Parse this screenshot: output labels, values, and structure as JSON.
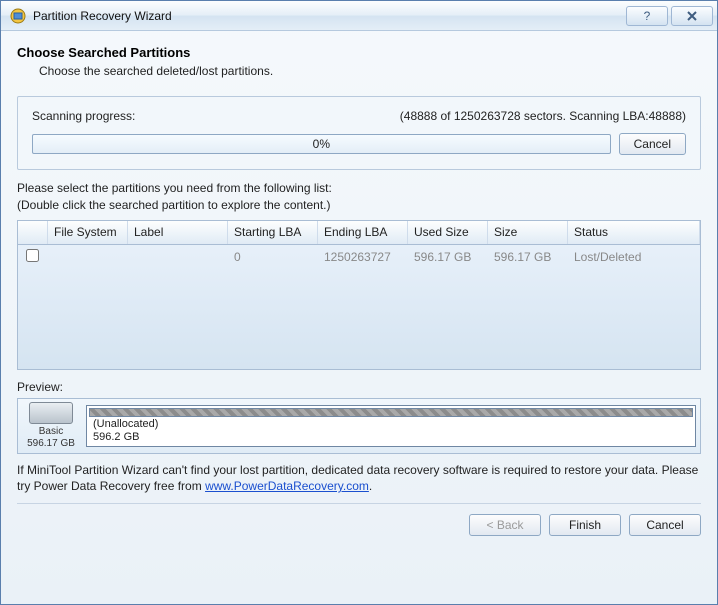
{
  "window": {
    "title": "Partition Recovery Wizard"
  },
  "header": {
    "title": "Choose Searched Partitions",
    "subtitle": "Choose the searched deleted/lost partitions."
  },
  "scan": {
    "label": "Scanning progress:",
    "status": "(48888 of 1250263728 sectors. Scanning LBA:48888)",
    "percent": "0%",
    "cancel": "Cancel"
  },
  "instructions": {
    "line1": "Please select the partitions you need from the following list:",
    "line2": "(Double click the searched partition to explore the content.)"
  },
  "table": {
    "headers": {
      "fs": "File System",
      "label": "Label",
      "slba": "Starting LBA",
      "elba": "Ending LBA",
      "used": "Used Size",
      "size": "Size",
      "status": "Status"
    },
    "rows": [
      {
        "fs": "",
        "label": "",
        "slba": "0",
        "elba": "1250263727",
        "used": "596.17 GB",
        "size": "596.17 GB",
        "status": "Lost/Deleted"
      }
    ]
  },
  "preview": {
    "label": "Preview:",
    "disk": {
      "type": "Basic",
      "size": "596.17 GB"
    },
    "segment": {
      "name": "(Unallocated)",
      "size": "596.2 GB"
    }
  },
  "note": {
    "text1": "If MiniTool Partition Wizard can't find your lost partition, dedicated data recovery software is required to restore your data. Please try Power Data Recovery free from ",
    "link": "www.PowerDataRecovery.com",
    "text2": "."
  },
  "buttons": {
    "back": "< Back",
    "finish": "Finish",
    "cancel": "Cancel"
  }
}
